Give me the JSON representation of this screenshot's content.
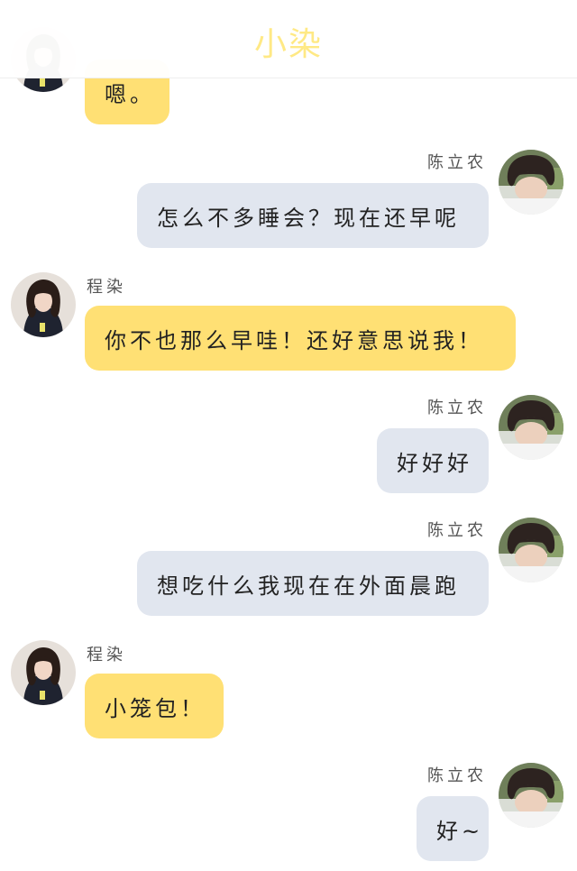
{
  "header": {
    "title": "小染"
  },
  "contacts": {
    "other": "程染",
    "self": "陈立农"
  },
  "messages": [
    {
      "sender": "other",
      "text": "嗯。"
    },
    {
      "sender": "self",
      "name": "陈立农",
      "text": "怎么不多睡会？现在还早呢"
    },
    {
      "sender": "other",
      "name": "程染",
      "text": "你不也那么早哇！还好意思说我！"
    },
    {
      "sender": "self",
      "name": "陈立农",
      "text": "好好好"
    },
    {
      "sender": "self",
      "name": "陈立农",
      "text": "想吃什么我现在在外面晨跑"
    },
    {
      "sender": "other",
      "name": "程染",
      "text": "小笼包！"
    },
    {
      "sender": "self",
      "name": "陈立农",
      "text": "好~"
    }
  ],
  "colors": {
    "incoming_bubble": "#ffe074",
    "outgoing_bubble": "#e1e6ef",
    "title": "#ffe985"
  },
  "icons": {
    "other_avatar": "girl-avatar-photo",
    "self_avatar": "boy-avatar-photo"
  }
}
